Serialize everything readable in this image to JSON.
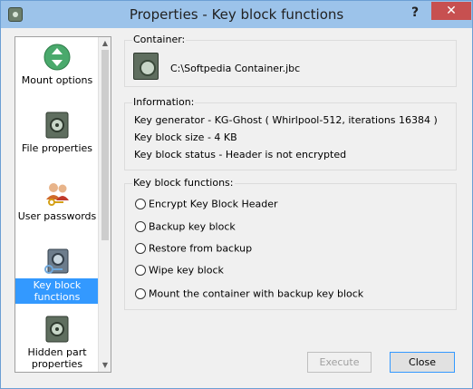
{
  "window": {
    "title": "Properties - Key block functions",
    "help_label": "?",
    "close_label": "✕"
  },
  "nav": {
    "items": [
      {
        "label": "Mount options",
        "icon": "mount-options-icon",
        "selected": false
      },
      {
        "label": "File properties",
        "icon": "file-properties-icon",
        "selected": false
      },
      {
        "label": "User passwords",
        "icon": "user-passwords-icon",
        "selected": false
      },
      {
        "label": "Key block functions",
        "icon": "key-block-functions-icon",
        "selected": true
      },
      {
        "label": "Hidden part properties",
        "icon": "hidden-part-properties-icon",
        "selected": false
      }
    ]
  },
  "container": {
    "title": "Container:",
    "path": "C:\\Softpedia Container.jbc"
  },
  "information": {
    "title": "Information:",
    "lines": [
      "Key generator - KG-Ghost ( Whirlpool-512, iterations 16384 )",
      "Key block size - 4 KB",
      "Key block status - Header is not encrypted"
    ]
  },
  "functions": {
    "title": "Key block functions:",
    "options": [
      "Encrypt Key Block Header",
      "Backup key block",
      "Restore from backup",
      "Wipe key block",
      "Mount the container with backup key block"
    ]
  },
  "buttons": {
    "execute": "Execute",
    "close": "Close"
  }
}
